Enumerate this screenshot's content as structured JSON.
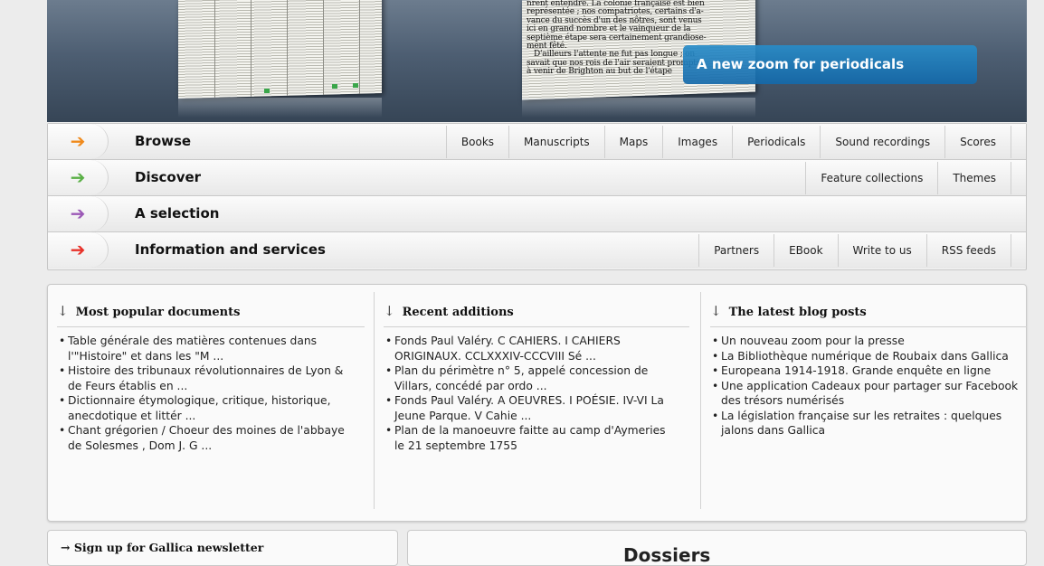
{
  "banner": {
    "caption": "A new zoom for periodicals",
    "newspaper_text": "nrent entendre. La colonie française est bien\nreprésentée ; nos compatriotes, certains d'a-\nvance du succès d'un des nôtres, sont venus\nici en grand nombre et le vainqueur de la\nseptième étape sera certainement grandiose-\nment fêté.\n   D'ailleurs l'attente ne fut pas longue ; on\nsavait que nos rois de l'air seraient prompts\nà venir de Brighton au but de l'étape"
  },
  "nav": {
    "rows": [
      {
        "arrow": "➔",
        "arrow_color": "#f08a1c",
        "title": "Browse",
        "links": [
          "Books",
          "Manuscripts",
          "Maps",
          "Images",
          "Periodicals",
          "Sound recordings",
          "Scores"
        ]
      },
      {
        "arrow": "➔",
        "arrow_color": "#5ab046",
        "title": "Discover",
        "links": [
          "Feature collections",
          "Themes"
        ]
      },
      {
        "arrow": "➔",
        "arrow_color": "#9b59b6",
        "title": "A selection",
        "links": []
      },
      {
        "arrow": "➔",
        "arrow_color": "#e8322a",
        "title": "Information and services",
        "links": [
          "Partners",
          "EBook",
          "Write to us",
          "RSS feeds"
        ]
      }
    ]
  },
  "info": {
    "columns": [
      {
        "heading": "Most popular documents",
        "items": [
          "Table générale des matières contenues dans l'\"Histoire\" et dans les \"M ...",
          "Histoire des tribunaux révolutionnaires de Lyon & de Feurs établis en ...",
          "Dictionnaire étymologique, critique, historique, anecdotique et littér ...",
          "Chant grégorien / Choeur des moines de l'abbaye de Solesmes , Dom J. G ..."
        ]
      },
      {
        "heading": "Recent additions",
        "items": [
          "Fonds Paul Valéry. C CAHIERS. I CAHIERS ORIGINAUX. CCLXXXIV-CCCVIII Sé ...",
          "Plan du périmètre n° 5, appelé concession de Villars, concédé par ordo ...",
          "Fonds Paul Valéry. A OEUVRES. I POÉSIE. IV-VI La Jeune Parque. V Cahie ...",
          "Plan de la manoeuvre faitte au camp d'Aymeries le 21 septembre 1755"
        ]
      },
      {
        "heading": "The latest blog posts",
        "items": [
          "Un nouveau zoom pour la presse",
          "La Bibliothèque numérique de Roubaix dans Gallica",
          "Europeana 1914-1918. Grande enquête en ligne",
          "Une application Cadeaux pour partager sur Facebook des trésors numérisés",
          "La législation française sur les retraites : quelques jalons dans Gallica"
        ]
      }
    ]
  },
  "newsletter": {
    "arrow": "→",
    "label": "Sign up for Gallica newsletter"
  },
  "right_box": {
    "title": "Dossiers"
  },
  "colors": {
    "caption_bg": "#1f7bbd",
    "panel_border": "#c9c9c9",
    "page_bg": "#ececec"
  }
}
